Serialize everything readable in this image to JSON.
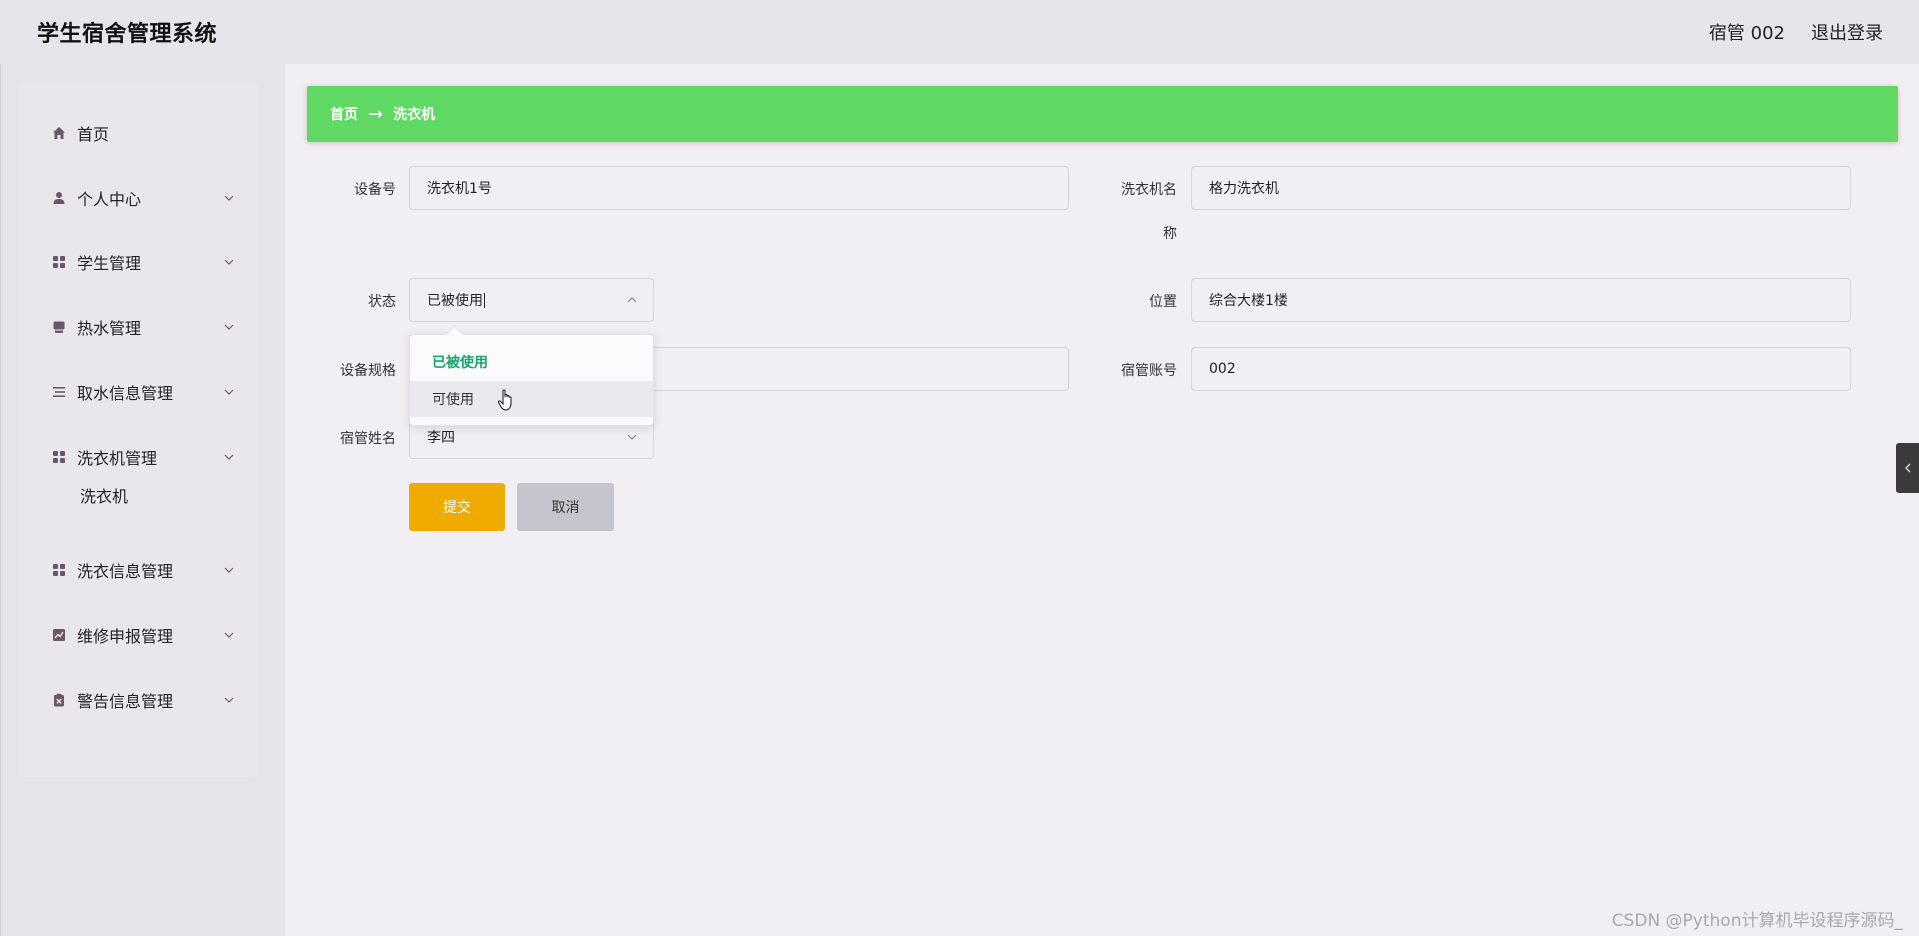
{
  "header": {
    "app_title": "学生宿舍管理系统",
    "user_label": "宿管 002",
    "logout_label": "退出登录"
  },
  "sidebar": {
    "items": [
      {
        "label": "首页",
        "icon": "home-icon"
      },
      {
        "label": "个人中心",
        "icon": "person-icon"
      },
      {
        "label": "学生管理",
        "icon": "grid-icon"
      },
      {
        "label": "热水管理",
        "icon": "monitor-icon"
      },
      {
        "label": "取水信息管理",
        "icon": "list-icon"
      },
      {
        "label": "洗衣机管理",
        "icon": "grid-icon"
      },
      {
        "label": "洗衣信息管理",
        "icon": "grid-icon"
      },
      {
        "label": "维修申报管理",
        "icon": "chart-icon"
      },
      {
        "label": "警告信息管理",
        "icon": "clipboard-x-icon"
      }
    ],
    "subitem": {
      "label": "洗衣机"
    }
  },
  "breadcrumb": {
    "home": "首页",
    "arrow": "→",
    "current": "洗衣机"
  },
  "form": {
    "device_no": {
      "label": "设备号",
      "value": "洗衣机1号"
    },
    "washer_name": {
      "label_line1": "洗衣机名",
      "label_line2": "称",
      "value": "格力洗衣机"
    },
    "status": {
      "label": "状态",
      "value": "已被使用"
    },
    "location": {
      "label": "位置",
      "value": "综合大楼1楼"
    },
    "spec": {
      "label": "设备规格",
      "value": ""
    },
    "manager_account": {
      "label": "宿管账号",
      "value": "002"
    },
    "manager_name": {
      "label": "宿管姓名",
      "value": "李四"
    }
  },
  "status_dropdown": {
    "options": [
      "已被使用",
      "可使用"
    ],
    "selected": "已被使用",
    "hovered": "可使用"
  },
  "buttons": {
    "submit": "提交",
    "cancel": "取消"
  },
  "watermark": "CSDN @Python计算机毕设程序源码_",
  "colors": {
    "breadcrumb_bg": "#5fd963",
    "submit_bg": "#f0ab00",
    "cancel_bg": "#c5c5cd",
    "selected_option": "#1aa36a"
  }
}
